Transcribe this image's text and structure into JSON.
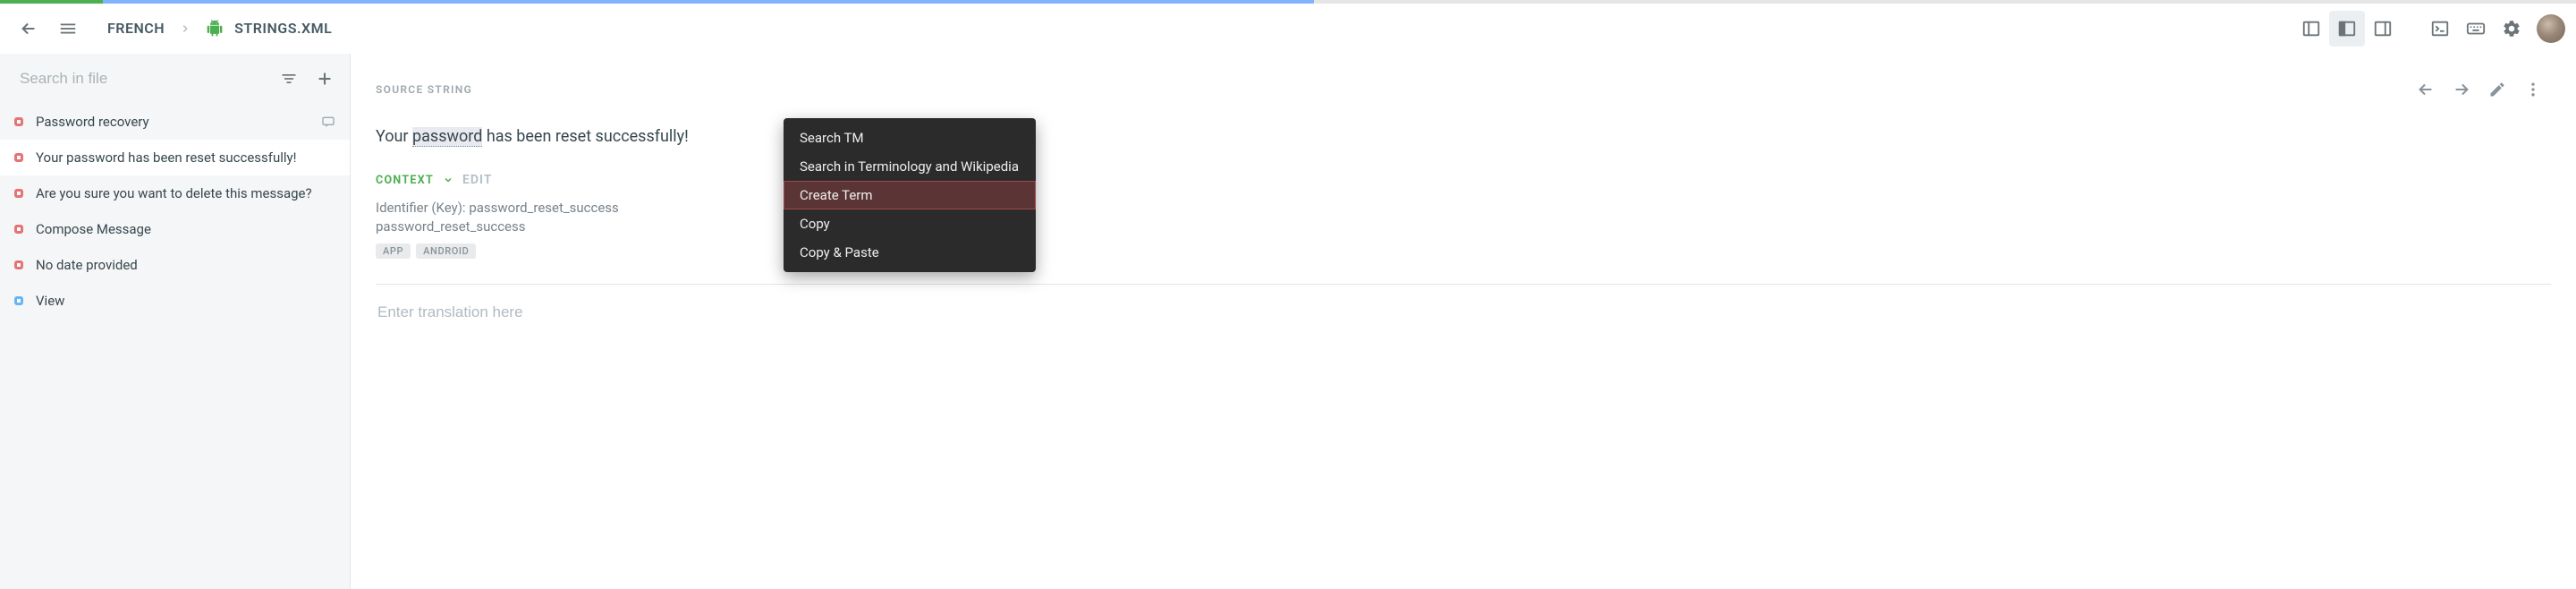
{
  "progress": {
    "green_pct": 4,
    "blue_pct": 47
  },
  "breadcrumb": {
    "lang": "FRENCH",
    "file": "STRINGS.XML"
  },
  "sidebar": {
    "search_placeholder": "Search in file",
    "items": [
      {
        "label": "Password recovery",
        "status": "red",
        "active": false,
        "trailing_icon": true
      },
      {
        "label": "Your password has been reset successfully!",
        "status": "red",
        "active": true
      },
      {
        "label": "Are you sure you want to delete this message?",
        "status": "red",
        "active": false
      },
      {
        "label": "Compose Message",
        "status": "red",
        "active": false
      },
      {
        "label": "No date provided",
        "status": "red",
        "active": false
      },
      {
        "label": "View",
        "status": "blue",
        "active": false
      }
    ]
  },
  "main": {
    "source_label": "SOURCE STRING",
    "source_prefix": "Your ",
    "source_highlight": "password",
    "source_suffix": " has been reset successfully!",
    "context_label": "CONTEXT",
    "context_edit": "EDIT",
    "identifier_label": "Identifier (Key):",
    "identifier_value": "password_reset_success",
    "identifier_line2": "password_reset_success",
    "tags": [
      "APP",
      "ANDROID"
    ],
    "translation_placeholder": "Enter translation here"
  },
  "context_menu": {
    "items": [
      {
        "label": "Search TM",
        "highlighted": false
      },
      {
        "label": "Search in Terminology and Wikipedia",
        "highlighted": false
      },
      {
        "label": "Create Term",
        "highlighted": true
      },
      {
        "label": "Copy",
        "highlighted": false
      },
      {
        "label": "Copy & Paste",
        "highlighted": false
      }
    ]
  }
}
